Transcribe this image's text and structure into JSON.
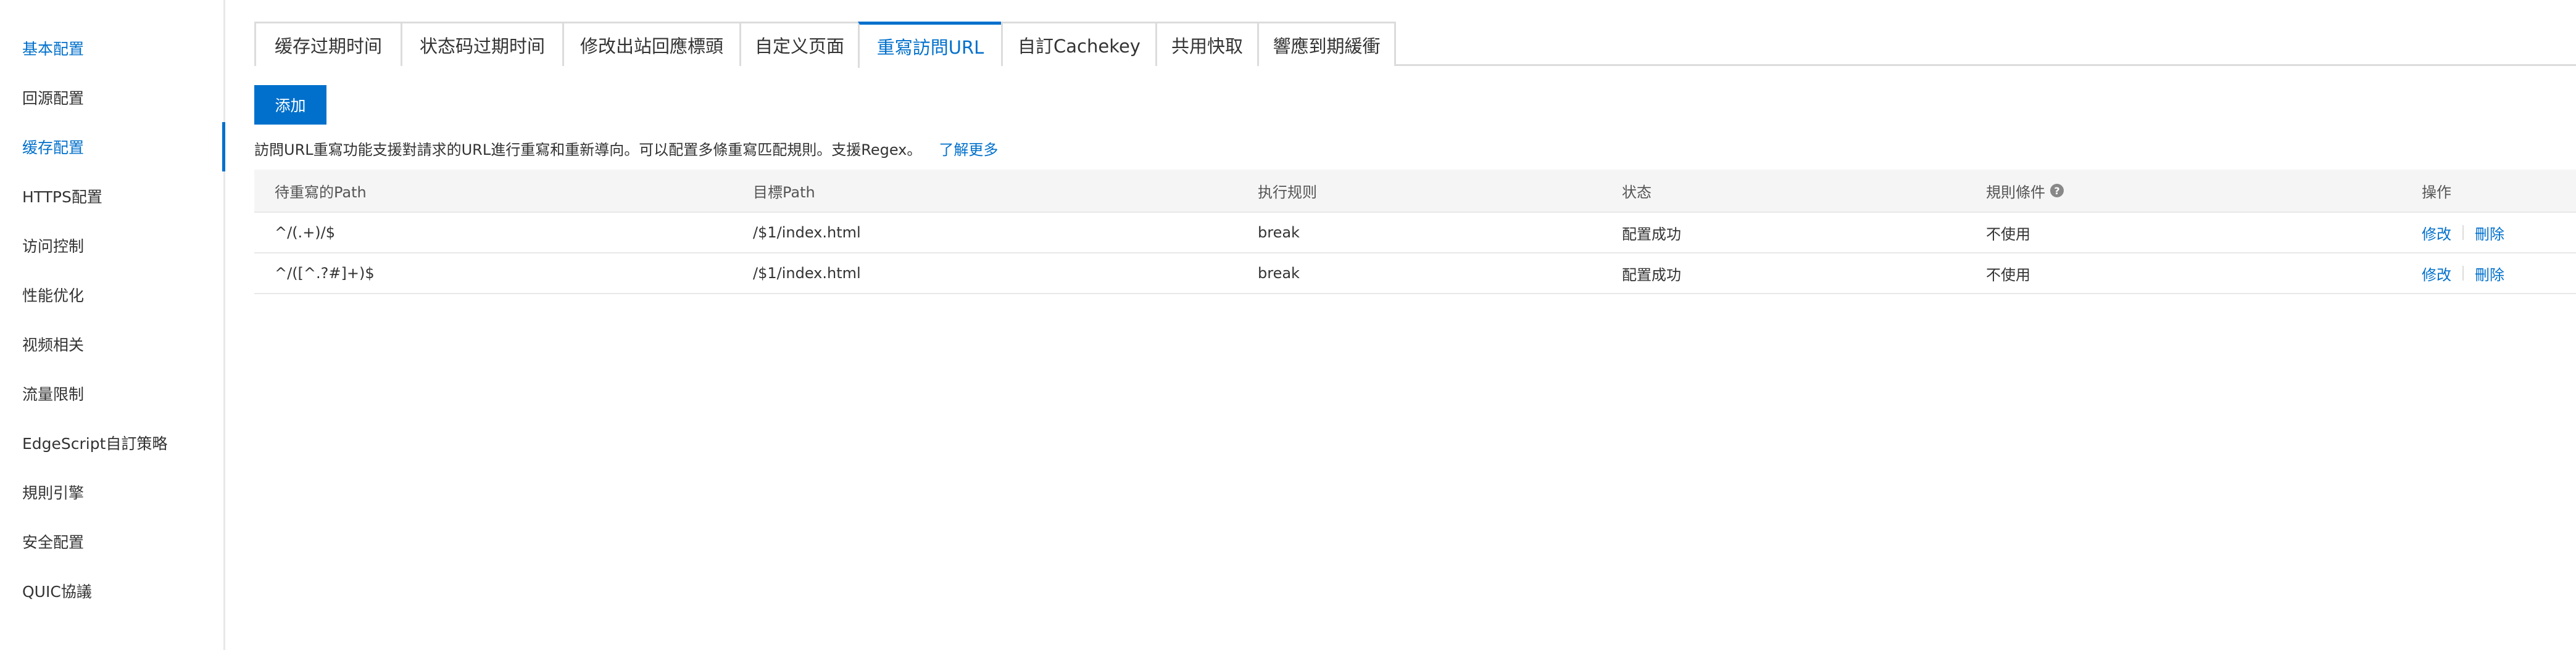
{
  "sidebar": {
    "items": [
      {
        "label": "基本配置"
      },
      {
        "label": "回源配置"
      },
      {
        "label": "缓存配置"
      },
      {
        "label": "HTTPS配置"
      },
      {
        "label": "访问控制"
      },
      {
        "label": "性能优化"
      },
      {
        "label": "视频相关"
      },
      {
        "label": "流量限制"
      },
      {
        "label": "EdgeScript自訂策略"
      },
      {
        "label": "規則引擎"
      },
      {
        "label": "安全配置"
      },
      {
        "label": "QUIC協議"
      }
    ],
    "selected_index": 2
  },
  "tabs": [
    {
      "label": "缓存过期时间"
    },
    {
      "label": "状态码过期时间"
    },
    {
      "label": "修改出站回應標頭"
    },
    {
      "label": "自定义页面"
    },
    {
      "label": "重寫訪問URL"
    },
    {
      "label": "自訂Cachekey"
    },
    {
      "label": "共用快取"
    },
    {
      "label": "響應到期緩衝"
    }
  ],
  "active_tab": "重寫訪問URL",
  "toolbar": {
    "add_label": "添加"
  },
  "description": {
    "text": "訪問URL重寫功能支援對請求的URL進行重寫和重新導向。可以配置多條重寫匹配規則。支援Regex。",
    "more_link": "了解更多"
  },
  "table": {
    "headers": {
      "source_path": "待重寫的Path",
      "target_path": "目標Path",
      "rule": "执行规则",
      "status": "状态",
      "condition": "規則條件",
      "actions": "操作"
    },
    "help_icon": "?",
    "rows": [
      {
        "source_path": "^/(.+)/$",
        "target_path": "/$1/index.html",
        "rule": "break",
        "status": "配置成功",
        "condition": "不使用",
        "edit": "修改",
        "delete": "刪除"
      },
      {
        "source_path": "^/([^.?#]+)$",
        "target_path": "/$1/index.html",
        "rule": "break",
        "status": "配置成功",
        "condition": "不使用",
        "edit": "修改",
        "delete": "刪除"
      }
    ]
  },
  "colors": {
    "accent": "#0070cc",
    "text": "#333333",
    "border": "#dcdcdc",
    "header_bg": "#f5f5f5"
  }
}
